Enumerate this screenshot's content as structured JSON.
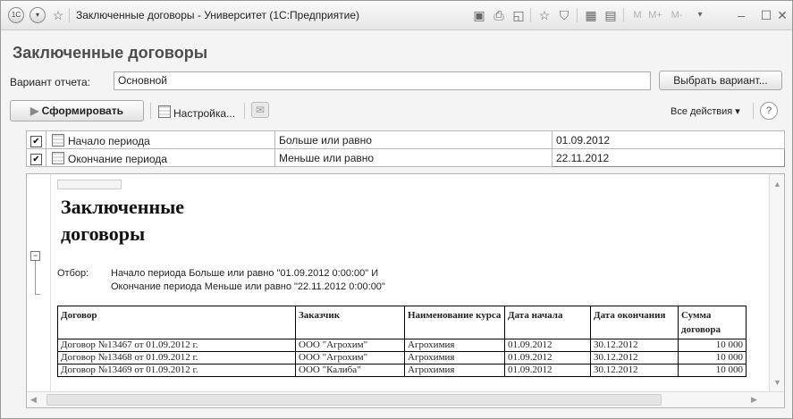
{
  "window": {
    "title": "Заключенные договоры - Университет (1С:Предприятие)",
    "app_icon": "1С",
    "toolbar_icons": [
      "save-icon",
      "print-icon",
      "preview-icon",
      "favorite-icon",
      "bookmark-icon",
      "calculator-icon",
      "calendar-icon"
    ],
    "memory_buttons": [
      "M",
      "M+",
      "M-"
    ],
    "controls": {
      "minimize": "–",
      "close": "✕"
    }
  },
  "form": {
    "title": "Заключенные договоры",
    "variant_label": "Вариант отчета:",
    "variant_value": "Основной",
    "choose_variant": "Выбрать вариант...",
    "generate": "Сформировать",
    "settings": "Настройка...",
    "all_actions": "Все действия ▾",
    "help": "?"
  },
  "filters": [
    {
      "checked": "✔",
      "name": "Начало периода",
      "condition": "Больше или равно",
      "value": "01.09.2012"
    },
    {
      "checked": "✔",
      "name": "Окончание периода",
      "condition": "Меньше или равно",
      "value": "22.11.2012"
    }
  ],
  "report": {
    "title_line1": "Заключенные",
    "title_line2": "договоры",
    "filter_label": "Отбор:",
    "filter_line1": "Начало периода Больше или равно \"01.09.2012 0:00:00\" И",
    "filter_line2": "Окончание периода Меньше или равно \"22.11.2012 0:00:00\"",
    "columns": [
      "Договор",
      "Заказчик",
      "Наименование курса",
      "Дата начала",
      "Дата окончания",
      "Сумма договора"
    ],
    "rows": [
      [
        "Договор №13467 от 01.09.2012 г.",
        "ООО \"Агрохим\"",
        "Агрохимия",
        "01.09.2012",
        "30.12.2012",
        "10 000"
      ],
      [
        "Договор №13468 от 01.09.2012 г.",
        "ООО \"Агрохим\"",
        "Агрохимия",
        "01.09.2012",
        "30.12.2012",
        "10 000"
      ],
      [
        "Договор №13469 от 01.09.2012 г.",
        "ООО \"Калиба\"",
        "Агрохимия",
        "01.09.2012",
        "30.12.2012",
        "10 000"
      ]
    ]
  }
}
